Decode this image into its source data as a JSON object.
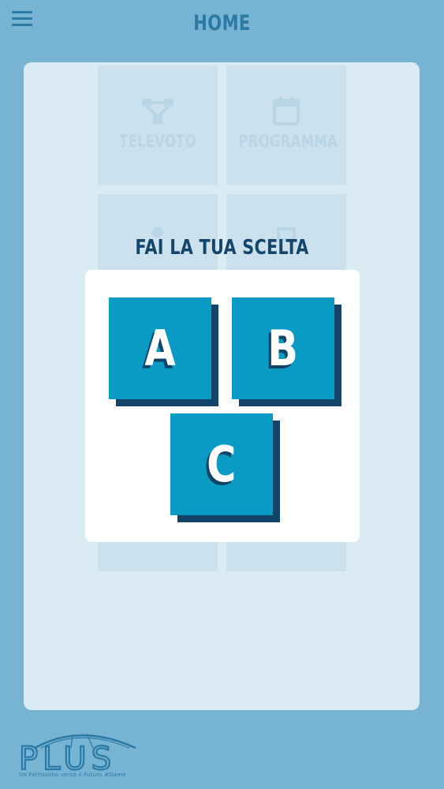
{
  "header": {
    "title": "HOME",
    "menu_icon": "hamburger-menu-icon"
  },
  "background_tiles": [
    {
      "label": "TELEVOTO",
      "icon": "network-icon"
    },
    {
      "label": "PROGRAMMA",
      "icon": "calendar-icon"
    },
    {
      "label": "",
      "icon": "person-icon"
    },
    {
      "label": "",
      "icon": "clipboard-icon"
    },
    {
      "label": "",
      "icon": ""
    },
    {
      "label": "",
      "icon": ""
    }
  ],
  "dialog": {
    "title": "FAI LA TUA SCELTA",
    "choices": [
      "A",
      "B",
      "C"
    ]
  },
  "logo": {
    "wordmark": "PLUS",
    "tagline": "Un Fortissimo verso il Futuro #Game"
  },
  "colors": {
    "background": "#77b3d3",
    "panel": "#dbebf4",
    "header_text": "#2b7aa6",
    "dialog_title": "#16456b",
    "choice_face": "#0a9bc5",
    "choice_shadow": "#14436a"
  }
}
